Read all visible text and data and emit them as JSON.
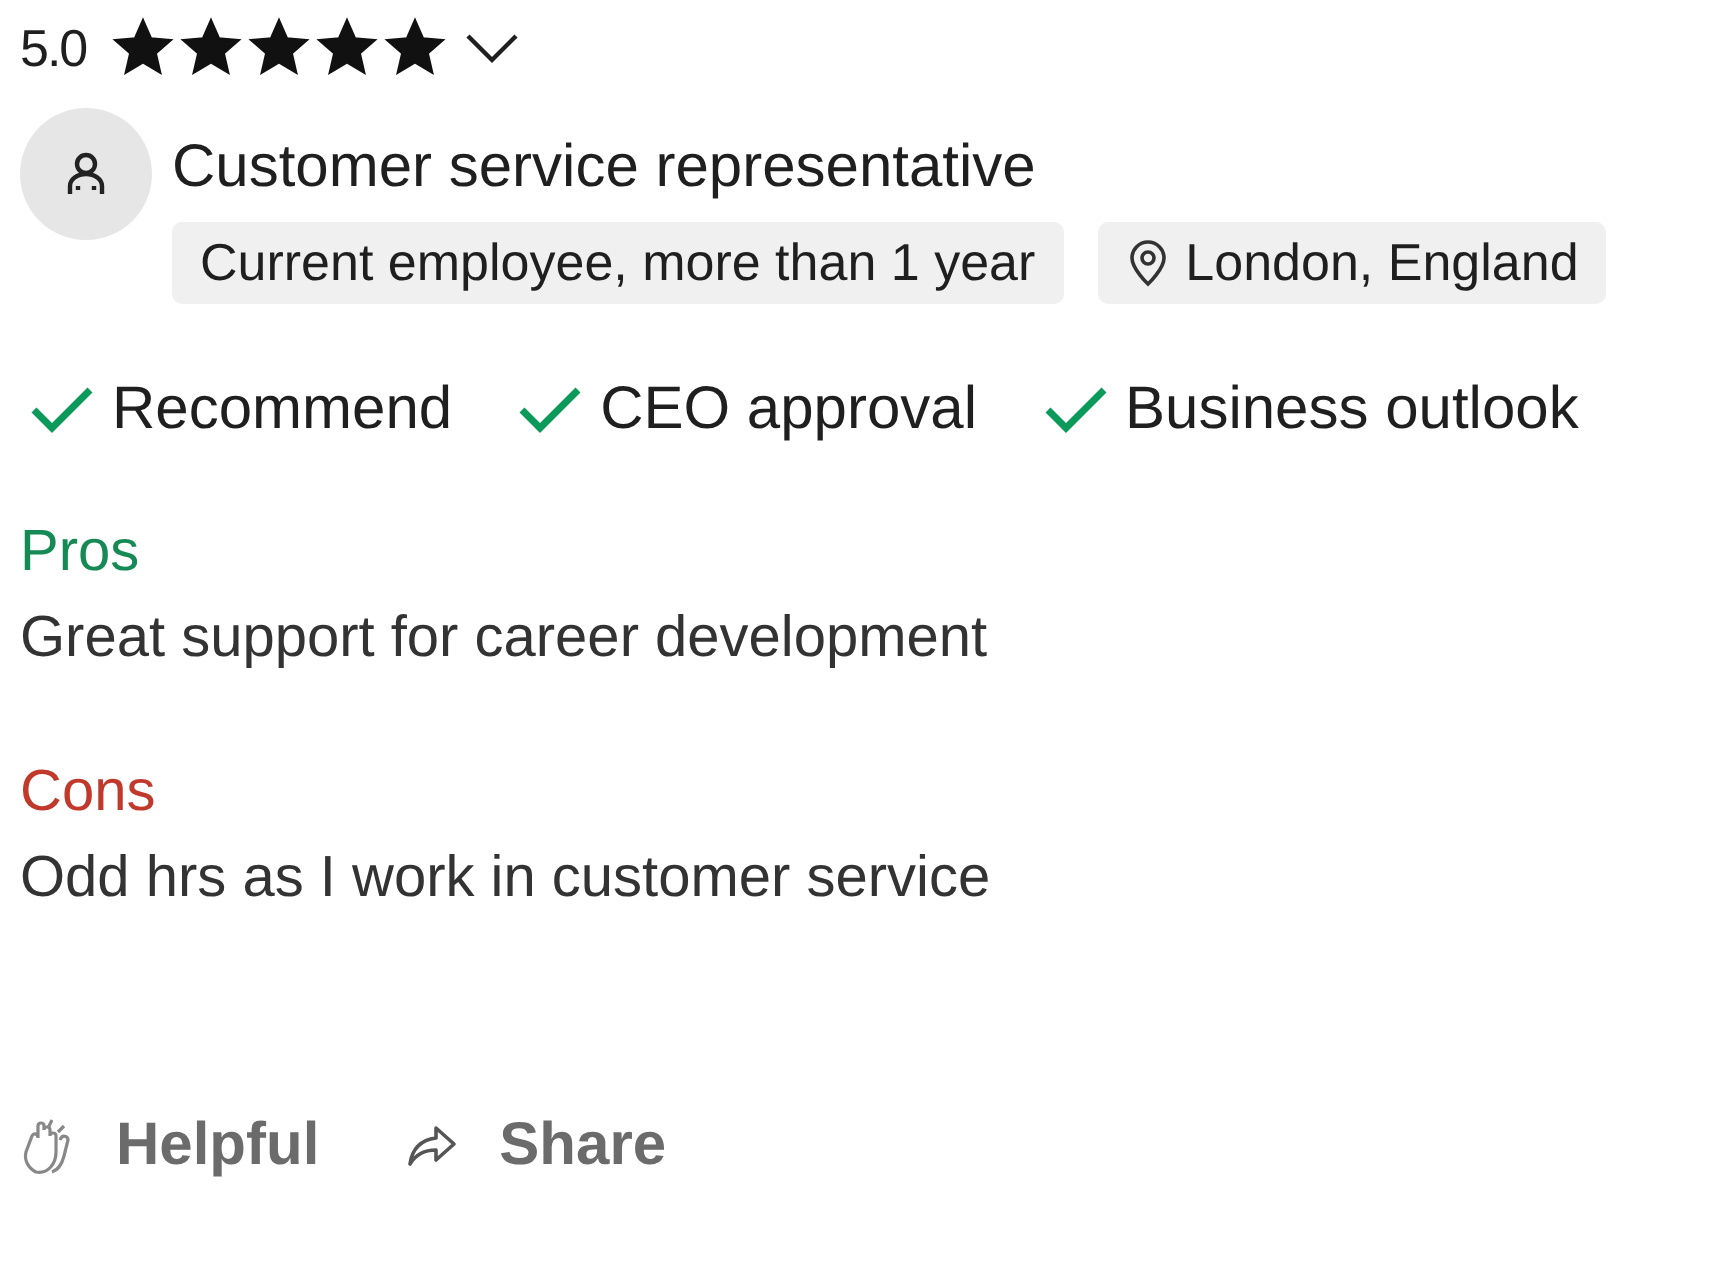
{
  "rating": {
    "value": "5.0",
    "stars": 5
  },
  "job_title": "Customer service representative",
  "tags": [
    {
      "kind": "status",
      "text": "Current employee, more than 1 year"
    },
    {
      "kind": "location",
      "text": "London, England"
    }
  ],
  "checks": [
    {
      "label": "Recommend",
      "checked": true
    },
    {
      "label": "CEO approval",
      "checked": true
    },
    {
      "label": "Business outlook",
      "checked": true
    }
  ],
  "pros": {
    "heading": "Pros",
    "text": "Great support for career development"
  },
  "cons": {
    "heading": "Cons",
    "text": "Odd hrs as I work in customer service"
  },
  "actions": [
    {
      "kind": "helpful",
      "label": "Helpful"
    },
    {
      "kind": "share",
      "label": "Share"
    }
  ]
}
